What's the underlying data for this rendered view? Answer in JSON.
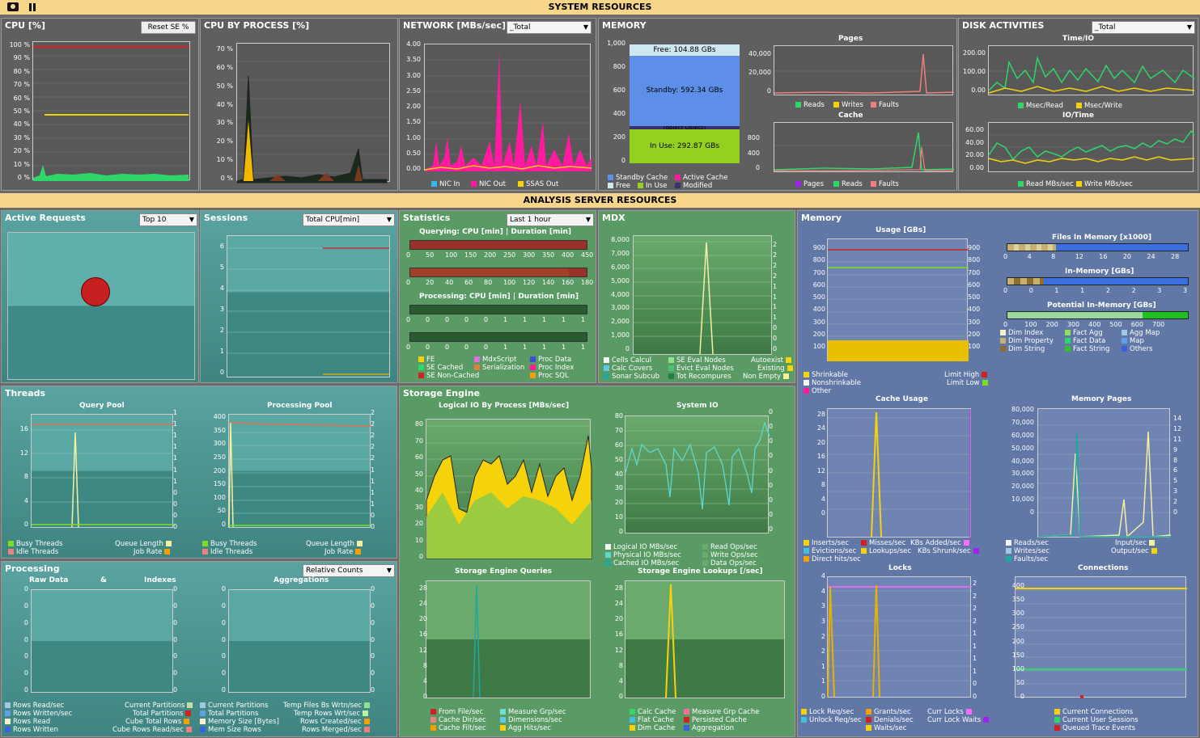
{
  "toolbar": {
    "icons": [
      "camera-icon",
      "pause-icon"
    ]
  },
  "sections": {
    "system": "SYSTEM RESOURCES",
    "analysis": "ANALYSIS SERVER RESOURCES"
  },
  "cpu": {
    "title": "CPU [%]",
    "reset_label": "Reset SE %",
    "yticks": [
      "100 %",
      "90 %",
      "80 %",
      "70 %",
      "60 %",
      "50 %",
      "40 %",
      "30 %",
      "20 %",
      "10 %",
      "0 %"
    ]
  },
  "cpu_process": {
    "title": "CPU BY PROCESS [%]",
    "yticks": [
      "70 %",
      "60 %",
      "50 %",
      "40 %",
      "30 %",
      "20 %",
      "10 %",
      "0 %"
    ]
  },
  "network": {
    "title": "NETWORK [MBs/sec]",
    "select": "_Total",
    "yticks": [
      "4.00",
      "3.50",
      "3.00",
      "2.50",
      "2.00",
      "1.50",
      "1.00",
      "0.50",
      "0.00"
    ],
    "legend": [
      "NIC In",
      "NIC Out",
      "SSAS Out"
    ]
  },
  "memory": {
    "title": "MEMORY",
    "yticks": [
      "1,000",
      "800",
      "600",
      "400",
      "200",
      "0"
    ],
    "free": "Free: 104.88 GBs",
    "standby": "Standby: 592.34 GBs",
    "cache": {
      "title": "Cache",
      "yticks": [
        "800",
        "400",
        "0"
      ],
      "legend": [
        "Pages",
        "Reads",
        "Faults"
      ]
    },
    "inuse": "In Use: 292.87 GBs",
    "legend": [
      "Standby Cache",
      "Active Cache",
      "Free",
      "In Use",
      "Modified"
    ],
    "pages": {
      "title": "Pages",
      "yticks": [
        "40,000",
        "20,000",
        "0"
      ],
      "legend": [
        "Reads",
        "Writes",
        "Faults"
      ]
    }
  },
  "disk": {
    "title": "DISK ACTIVITIES",
    "select": "_Total",
    "timeio": {
      "title": "Time/IO",
      "yticks": [
        "200.00",
        "100.00",
        "0.00"
      ],
      "legend": [
        "Msec/Read",
        "Msec/Write"
      ]
    },
    "iotime": {
      "title": "IO/Time",
      "yticks": [
        "60.00",
        "40.00",
        "20.00",
        "0.00"
      ],
      "legend": [
        "Read MBs/sec",
        "Write MBs/sec"
      ]
    }
  },
  "active": {
    "title": "Active Requests",
    "select": "Top 10"
  },
  "sessions": {
    "title": "Sessions",
    "select": "Total CPU[min]",
    "yticks": [
      "6",
      "5",
      "4",
      "3",
      "2",
      "1",
      "0"
    ]
  },
  "statistics": {
    "title": "Statistics",
    "select": "Last 1 hour",
    "q_title": "Querying: CPU [min]  |  Duration [min]",
    "q1": [
      "0",
      "50",
      "100",
      "150",
      "200",
      "250",
      "300",
      "350",
      "400",
      "450"
    ],
    "q2": [
      "0",
      "20",
      "40",
      "60",
      "80",
      "100",
      "120",
      "140",
      "160",
      "180"
    ],
    "p_title": "Processing: CPU [min]  |  Duration [min]",
    "p1": [
      "0",
      "0",
      "0",
      "0",
      "0",
      "1",
      "1",
      "1",
      "1",
      "1"
    ],
    "p2": [
      "0",
      "0",
      "0",
      "0",
      "0",
      "1",
      "1",
      "1",
      "1",
      "1"
    ],
    "legend": [
      "FE",
      "MdxScript",
      "Proc Data",
      "SE Cached",
      "Serialization",
      "Proc Index",
      "SE Non-Cached",
      "Proc SQL"
    ]
  },
  "mdx": {
    "title": "MDX",
    "yticks": [
      "8,000",
      "7,000",
      "6,000",
      "5,000",
      "4,000",
      "3,000",
      "2,000",
      "1,000",
      "0"
    ],
    "rticks": [
      "2",
      "2",
      "2",
      "2",
      "1",
      "1",
      "1",
      "1",
      "0",
      "0",
      "0"
    ],
    "legend": [
      "Cells Calcul",
      "SE Eval Nodes",
      "Autoexist",
      "Calc Covers",
      "Evict Eval Nodes",
      "Existing",
      "Sonar Subcub",
      "Tot Recompures",
      "Non Empty"
    ]
  },
  "memory2": {
    "title": "Memory",
    "usage_title": "Usage [GBs]",
    "yticks": [
      "900",
      "800",
      "700",
      "600",
      "500",
      "400",
      "300",
      "200",
      "100"
    ],
    "legend": [
      "Shrinkable",
      "Limit High",
      "Nonshrinkable",
      "Limit Low",
      "Other"
    ],
    "files_title": "Files In Memory [x1000]",
    "files_ticks": [
      "0",
      "4",
      "8",
      "12",
      "16",
      "20",
      "24",
      "28"
    ],
    "inmem_title": "In-Memory [GBs]",
    "inmem_ticks": [
      "0",
      "0",
      "1",
      "1",
      "2",
      "2",
      "3",
      "3"
    ],
    "pot_title": "Potential In-Memory [GBs]",
    "pot_ticks": [
      "0",
      "100",
      "200",
      "300",
      "400",
      "500",
      "600",
      "700"
    ],
    "legend2": [
      "Dim Index",
      "Fact Agg",
      "Agg Map",
      "Dim Property",
      "Fact Data",
      "Map",
      "Dim String",
      "Fact String",
      "Others"
    ]
  },
  "threads": {
    "title": "Threads",
    "qp": "Query Pool",
    "pp": "Processing Pool",
    "qy": [
      "16",
      "12",
      "8",
      "4",
      "0"
    ],
    "qr": [
      "1",
      "1",
      "1",
      "1",
      "1",
      "1",
      "1",
      "0",
      "0",
      "0",
      "0"
    ],
    "py": [
      "400",
      "350",
      "300",
      "250",
      "200",
      "150",
      "100",
      "50",
      "0"
    ],
    "pr": [
      "2",
      "2",
      "2",
      "2",
      "2",
      "1",
      "1",
      "1",
      "1",
      "0",
      "0"
    ],
    "legend": [
      "Busy Threads",
      "Queue Length",
      "Idle Threads",
      "Job Rate"
    ]
  },
  "storage": {
    "title": "Storage Engine",
    "lio": "Logical IO By Process [MBs/sec]",
    "lioy": [
      "80",
      "70",
      "60",
      "50",
      "40",
      "30",
      "20",
      "10",
      "0"
    ],
    "sio": "System IO",
    "sioy": [
      "80",
      "70",
      "60",
      "50",
      "40",
      "30",
      "20",
      "10",
      "0"
    ],
    "sior": [
      "0",
      "0",
      "0",
      "0",
      "0",
      "0",
      "0",
      "0",
      "0"
    ],
    "legend_sio": [
      "Logical IO MBs/sec",
      "Read Ops/sec",
      "Physical IO MBs/sec",
      "Write Ops/sec",
      "Cached IO MBs/sec",
      "Data Ops/sec"
    ],
    "seq": "Storage Engine Queries",
    "seqy": [
      "28",
      "24",
      "20",
      "16",
      "12",
      "8",
      "4",
      "0"
    ],
    "sel": "Storage Engine Lookups [/sec]",
    "sely": [
      "28",
      "24",
      "20",
      "16",
      "12",
      "8",
      "4",
      "0"
    ],
    "legend_q": [
      "From File/sec",
      "Measure Grp/sec",
      "Cache Dir/sec",
      "Dimensions/sec",
      "Cache Filt/sec",
      "Agg Hits/sec"
    ],
    "legend_l": [
      "Calc Cache",
      "Measure Grp Cache",
      "Flat Cache",
      "Persisted Cache",
      "Dim Cache",
      "Aggregation"
    ]
  },
  "processing": {
    "title": "Processing",
    "select": "Relative Counts",
    "raw": "Raw Data",
    "amp": "&",
    "idx": "Indexes",
    "agg": "Aggregations",
    "ticks": [
      "0",
      "0",
      "0",
      "0",
      "0",
      "0",
      "0"
    ],
    "legend1": [
      "Rows Read/sec",
      "Current Partitions",
      "Rows Written/sec",
      "Total Partitions",
      "Rows Read",
      "Cube Total Rows",
      "Rows Written",
      "Cube Rows Read/sec"
    ],
    "legend2": [
      "Current Partitions",
      "Temp Files Bs Wrtn/sec",
      "Total Partitions",
      "Temp Rows Wrt/sec",
      "Memory Size [Bytes]",
      "Rows Created/sec",
      "Mem Size Rows",
      "Rows Merged/sec"
    ]
  },
  "cache_usage": {
    "title": "Cache Usage",
    "y": [
      "28",
      "24",
      "20",
      "16",
      "12",
      "8",
      "4",
      "0"
    ],
    "legend": [
      "Inserts/sec",
      "Misses/sec",
      "KBs Added/sec",
      "Evictions/sec",
      "Lookups/sec",
      "KBs Shrunk/sec",
      "Direct hits/sec"
    ]
  },
  "mem_pages": {
    "title": "Memory Pages",
    "y": [
      "80,000",
      "70,000",
      "60,000",
      "50,000",
      "40,000",
      "30,000",
      "20,000",
      "10,000",
      "0"
    ],
    "r": [
      "14",
      "12",
      "11",
      "9",
      "8",
      "6",
      "5",
      "3",
      "2",
      "0"
    ],
    "legend": [
      "Reads/sec",
      "Input/sec",
      "Writes/sec",
      "Output/sec",
      "Faults/sec"
    ]
  },
  "locks": {
    "title": "Locks",
    "y": [
      "4",
      "4",
      "3",
      "3",
      "2",
      "2",
      "1",
      "1",
      "0"
    ],
    "r": [
      "2",
      "2",
      "2",
      "2",
      "1",
      "1",
      "1",
      "1",
      "0",
      "0"
    ],
    "legend": [
      "Lock Req/sec",
      "Grants/sec",
      "Curr Locks",
      "Unlock Req/sec",
      "Denials/sec",
      "Curr Lock Waits",
      "Waits/sec"
    ]
  },
  "connections": {
    "title": "Connections",
    "y": [
      "400",
      "350",
      "300",
      "250",
      "200",
      "150",
      "100",
      "50",
      "0"
    ],
    "legend": [
      "Current Connections",
      "Current User Sessions",
      "Queued Trace Events"
    ]
  },
  "colors": {
    "yellow": "#f5d20a",
    "red": "#d0202a",
    "green": "#2fd66a",
    "pink": "#ff1aa0",
    "salmon": "#f08080",
    "teal": "#20a8a0",
    "cream": "#f4f0a0"
  }
}
